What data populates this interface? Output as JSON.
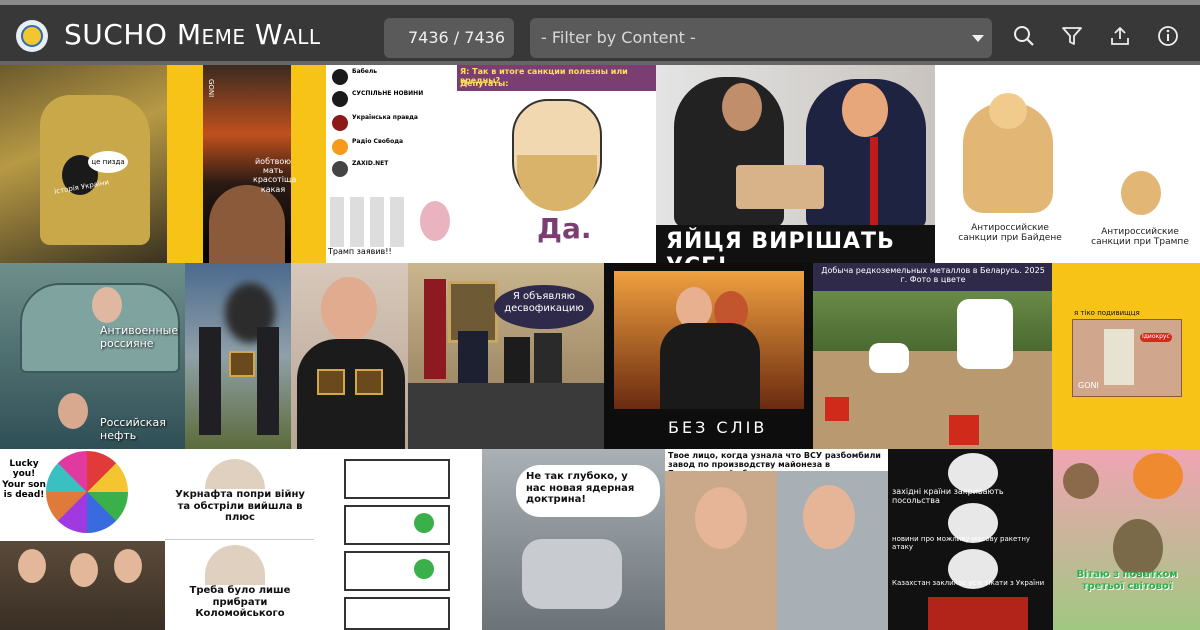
{
  "app": {
    "title": "SUCHO Meme Wall",
    "counter": "7436 / 7436",
    "filter_placeholder": "- Filter by Content -"
  },
  "icons": [
    "search-icon",
    "filter-icon",
    "share-icon",
    "info-icon"
  ],
  "colors": {
    "header_bg": "#383838",
    "accent": "#f5c531"
  },
  "memes": {
    "m1": {
      "caption": "це пизда",
      "caption2": "історія України"
    },
    "m2": {
      "caption": "йобтвою мать красотіща какая",
      "logo": "GONI"
    },
    "m3": {
      "sources": [
        "Бабель",
        "СУСПІЛЬНЕ НОВИНИ",
        "Українська правда",
        "Радіо Свобода",
        "ZAXID.NET"
      ],
      "bottom": "Трамп заявив!!"
    },
    "m4": {
      "question": "Я: Так в итоге санкции полезны или вредны?",
      "deputies": "Депутаты:",
      "answer": "Да."
    },
    "m5": {
      "caption": "ЯЙЦЯ ВИРІШАТЬ УСЕ!"
    },
    "m6": {
      "left": "Антироссийские санкции при Байдене",
      "right": "Антироссийские санкции при Трампе"
    },
    "m7": {
      "top": "Антивоенные россияне",
      "bottom": "Российская нефть"
    },
    "m9": {
      "bubble": "Я объявляю десвофикацию"
    },
    "m10": {
      "caption": "БЕЗ СЛІВ"
    },
    "m11": {
      "title": "Добыча редкоземельных металлов в Беларусь. 2025 г. Фото в цвете"
    },
    "m12": {
      "top": "я тіко подивищця",
      "logo": "GONI",
      "label": "Ідиокрус"
    },
    "m13": {
      "text": "Lucky you! Your son is dead!"
    },
    "m14": {
      "top": "Укрнафта попри війну та обстріли вийшла в плюс",
      "bottom": "Треба було лише прибрати Коломойського"
    },
    "m16": {
      "bubble": "Не так глубоко, у нас новая ядерная доктрина!"
    },
    "m17": {
      "title": "Твое лицо, когда узнала что ВСУ разбомбили завод по производству майонеза в Белгородской области"
    },
    "m18": {
      "captions": [
        "західні країни закривають посольства",
        "новини про можливу масову ракетну атаку",
        "Казахстан закликає усіх тікати з України"
      ]
    },
    "m19": {
      "caption": "Вітаю з початком третьої світової"
    }
  }
}
